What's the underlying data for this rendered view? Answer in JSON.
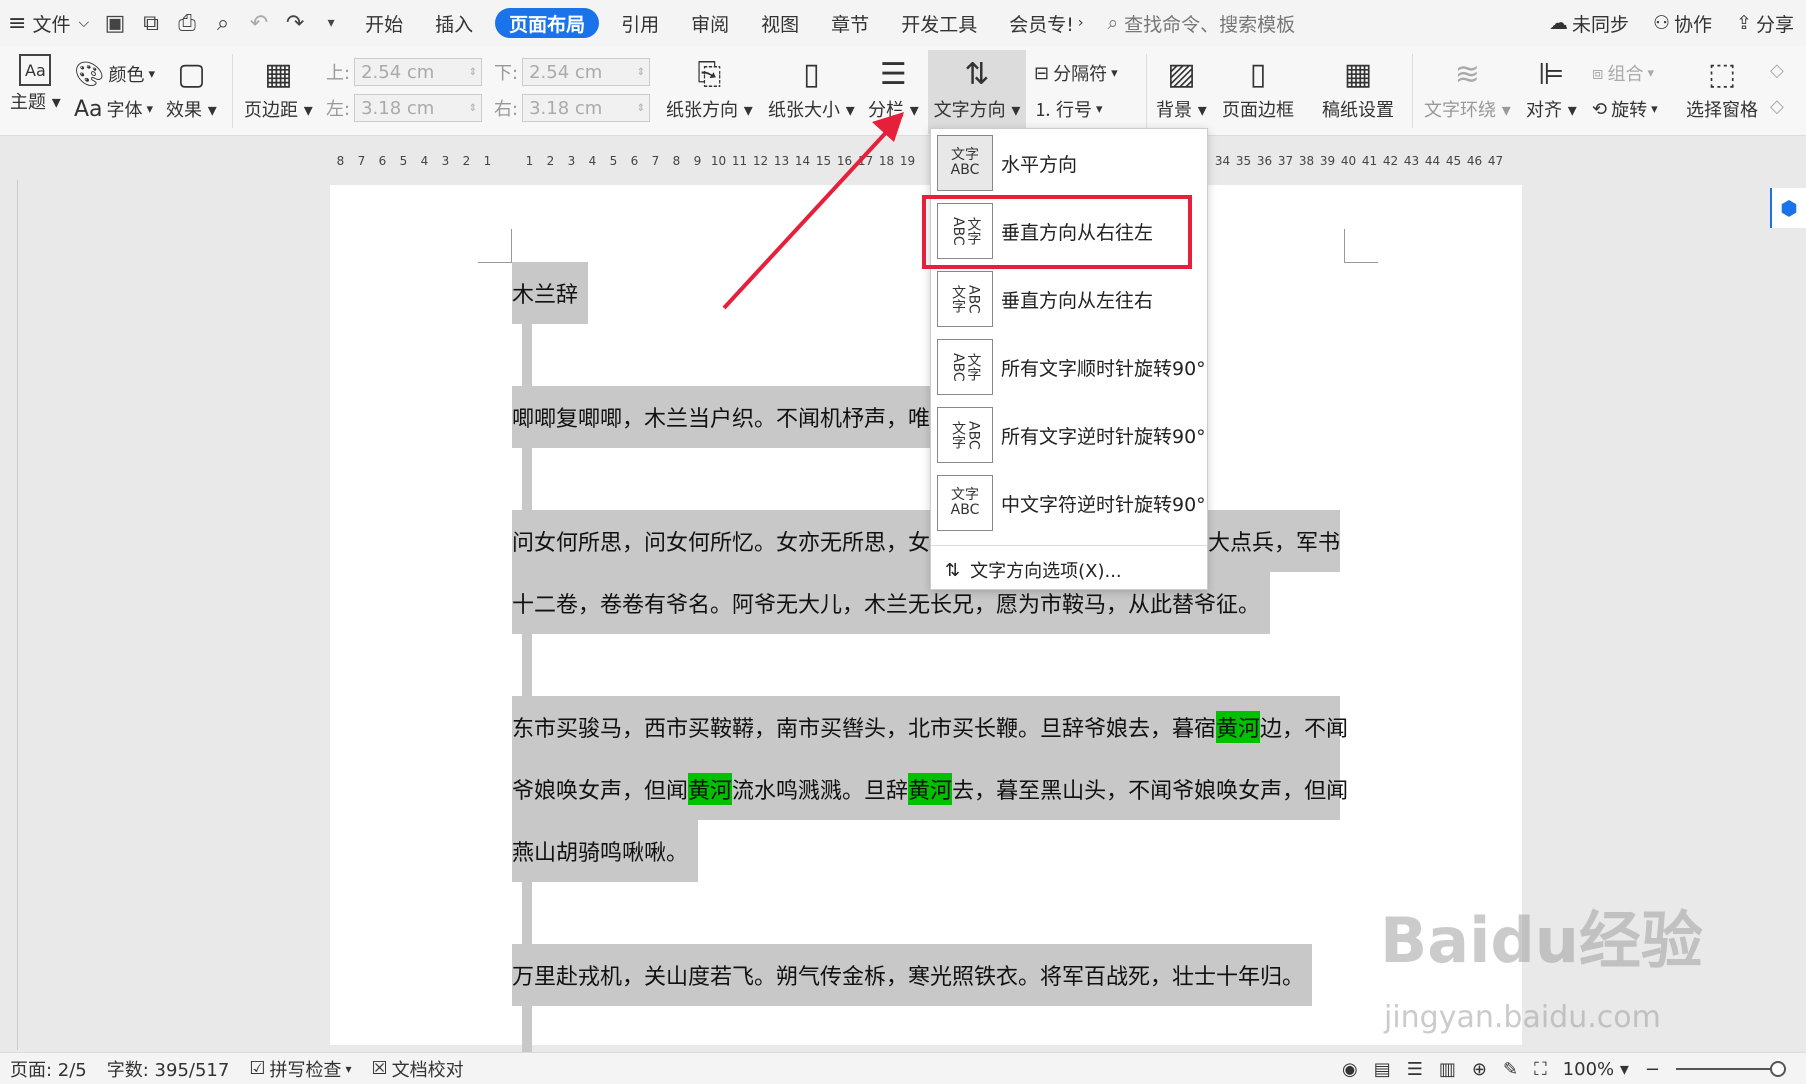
{
  "tabbar": {
    "menu_icon": "hamburger-icon",
    "file": "文件",
    "tabs": [
      "开始",
      "插入",
      "页面布局",
      "引用",
      "审阅",
      "视图",
      "章节",
      "开发工具",
      "会员专!"
    ],
    "active_tab": "页面布局",
    "search": "查找命令、搜索模板",
    "sync": "未同步",
    "collab": "协作",
    "share": "分享"
  },
  "ribbon": {
    "theme": "主题",
    "color": "颜色",
    "font": "字体",
    "effect": "效果",
    "margin": "页边距",
    "top_label": "上:",
    "top_value": "2.54 cm",
    "bottom_label": "下:",
    "bottom_value": "2.54 cm",
    "left_label": "左:",
    "left_value": "3.18 cm",
    "right_label": "右:",
    "right_value": "3.18 cm",
    "orientation": "纸张方向",
    "size": "纸张大小",
    "columns": "分栏",
    "text_dir": "文字方向",
    "separator": "分隔符",
    "line_num": "行号",
    "background": "背景",
    "border": "页面边框",
    "grid_paper": "稿纸设置",
    "wrap": "文字环绕",
    "align": "对齐",
    "group": "组合",
    "rotate": "旋转",
    "select_pane": "选择窗格"
  },
  "ruler": [
    "8",
    "7",
    "6",
    "5",
    "4",
    "3",
    "2",
    "1",
    "",
    "1",
    "2",
    "3",
    "4",
    "5",
    "6",
    "7",
    "8",
    "9",
    "10",
    "11",
    "12",
    "13",
    "14",
    "15",
    "16",
    "17",
    "18",
    "19"
  ],
  "ruler_right": [
    "34",
    "35",
    "36",
    "37",
    "38",
    "39",
    "40",
    "41",
    "42",
    "43",
    "44",
    "45",
    "46",
    "47"
  ],
  "doc": {
    "title": "木兰辞",
    "line1": "唧唧复唧唧，木兰当户织。不闻机杼声，唯",
    "line2": "问女何所思，问女何所忆。女亦无所思，女",
    "line2_tail": "大点兵，军书",
    "line3": "十二卷，卷卷有爷名。阿爷无大儿，木兰无长兄，愿为市鞍马，从此替爷征。",
    "line4_a": "东市买骏马，西市买鞍鞯，南市买辔头，北市买长鞭。旦辞爷娘去，暮宿",
    "line4_hl": "黄河",
    "line4_b": "边，不闻",
    "line5_a": "爷娘唤女声，但闻",
    "line5_hl1": "黄河",
    "line5_b": "流水鸣溅溅。旦辞",
    "line5_hl2": "黄河",
    "line5_c": "去，暮至黑山头，不闻爷娘唤女声，但闻",
    "line6": "燕山胡骑鸣啾啾。",
    "line7": "万里赴戎机，关山度若飞。朔气传金柝，寒光照铁衣。将军百战死，壮士十年归。"
  },
  "dropdown": {
    "items": [
      {
        "label": "水平方向",
        "icon_top": "文字",
        "icon_bottom": "ABC"
      },
      {
        "label": "垂直方向从右往左",
        "icon_top": "文字",
        "icon_bottom": "ABC"
      },
      {
        "label": "垂直方向从左往右",
        "icon_top": "文字",
        "icon_bottom": "ABC"
      },
      {
        "label": "所有文字顺时针旋转90°",
        "icon_top": "文字",
        "icon_bottom": "ABC"
      },
      {
        "label": "所有文字逆时针旋转90°",
        "icon_top": "文字",
        "icon_bottom": "ABC"
      },
      {
        "label": "中文字符逆时针旋转90°",
        "icon_top": "文字",
        "icon_bottom": "ABC"
      }
    ],
    "options": "文字方向选项(X)...",
    "highlighted_index": 1
  },
  "status": {
    "page": "页面: 2/5",
    "words": "字数: 395/517",
    "spell": "拼写检查",
    "proof": "文档校对",
    "zoom": "100%"
  },
  "watermark": {
    "main": "Baidu经验",
    "sub": "jingyan.baidu.com"
  },
  "colors": {
    "accent": "#1a73e8",
    "highlight_gray": "#c8c8c8",
    "highlight_green": "#00c000",
    "callout_red": "#e6203a"
  }
}
